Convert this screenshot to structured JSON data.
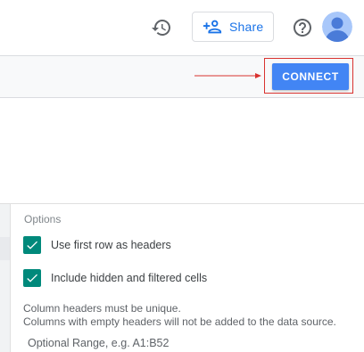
{
  "header": {
    "history_icon": "history-icon",
    "share": {
      "icon": "person-add-icon",
      "label": "Share",
      "color": "#1a73e8"
    },
    "help_icon": "help-circle-icon",
    "avatar_icon": "account-avatar-icon"
  },
  "connect_bar": {
    "connect_label": "CONNECT",
    "button_color": "#4285f4",
    "highlight_color": "#d9322f"
  },
  "options": {
    "title": "Options",
    "checkboxes": [
      {
        "label": "Use first row as headers",
        "checked": true
      },
      {
        "label": "Include hidden and filtered cells",
        "checked": true
      }
    ],
    "checkbox_color": "#00897b",
    "notes": [
      "Column headers must be unique.",
      "Columns with empty headers will not be added to the data source."
    ],
    "range_placeholder": "Optional Range, e.g. A1:B52"
  }
}
